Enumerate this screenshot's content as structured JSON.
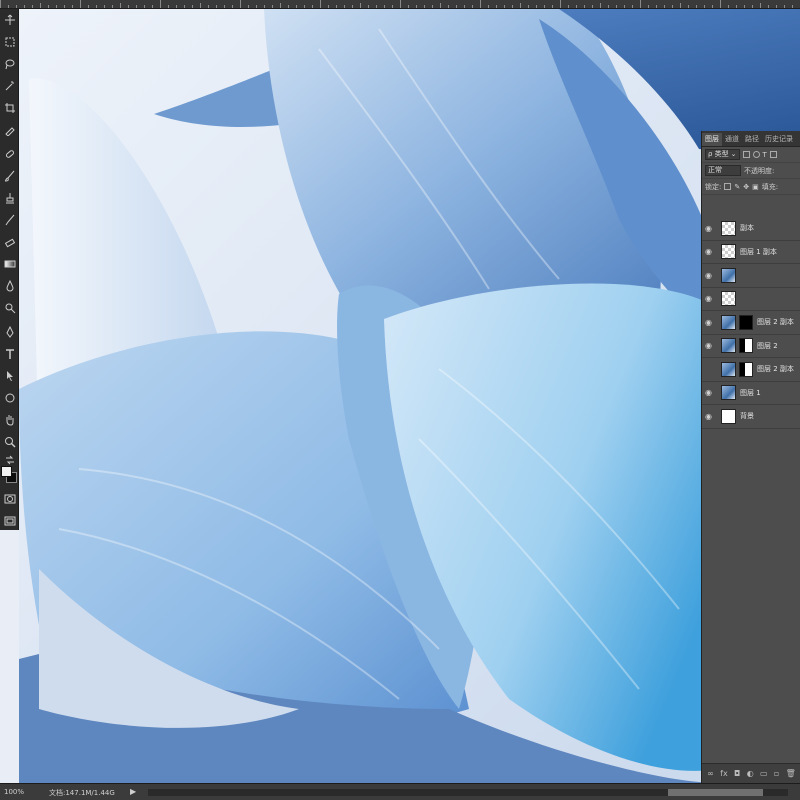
{
  "status": {
    "zoom": "100%",
    "doc_info": "文档:147.1M/1.44G",
    "menu_arrow": "▶"
  },
  "layers_panel": {
    "tabs": [
      "图层",
      "通道",
      "路径",
      "历史记录"
    ],
    "filter_label": "ρ 类型",
    "blend_mode": "正常",
    "opacity_label": "不透明度:",
    "lock_label": "锁定:",
    "fill_label": "填充:",
    "layers": [
      {
        "name": "副本",
        "thumb": "checker",
        "mask": null
      },
      {
        "name": "图层 1 副本",
        "thumb": "checker",
        "mask": null
      },
      {
        "name": "",
        "thumb": "img",
        "mask": null
      },
      {
        "name": "",
        "thumb": "checker",
        "mask": null
      },
      {
        "name": "图层 2 副本",
        "thumb": "img",
        "mask": "black"
      },
      {
        "name": "图层 2",
        "thumb": "img",
        "mask": "white"
      },
      {
        "name": "图层 2 副本",
        "thumb": "img",
        "mask": "white"
      },
      {
        "name": "图层 1",
        "thumb": "img",
        "mask": null
      },
      {
        "name": "背景",
        "thumb": "white",
        "mask": null
      }
    ],
    "footer_icons": [
      "link-icon",
      "fx-icon",
      "mask-icon",
      "adjustment-icon",
      "folder-icon",
      "new-layer-icon",
      "trash-icon"
    ],
    "footer_glyphs": [
      "∞",
      "fx",
      "◘",
      "◐",
      "▭",
      "▫",
      "🗑"
    ]
  },
  "colors": {
    "foreground": "#f2f2f2",
    "background": "#0d0d0d",
    "panel": "#4d4d4d",
    "canvas_accent": "#6fa3d8"
  }
}
